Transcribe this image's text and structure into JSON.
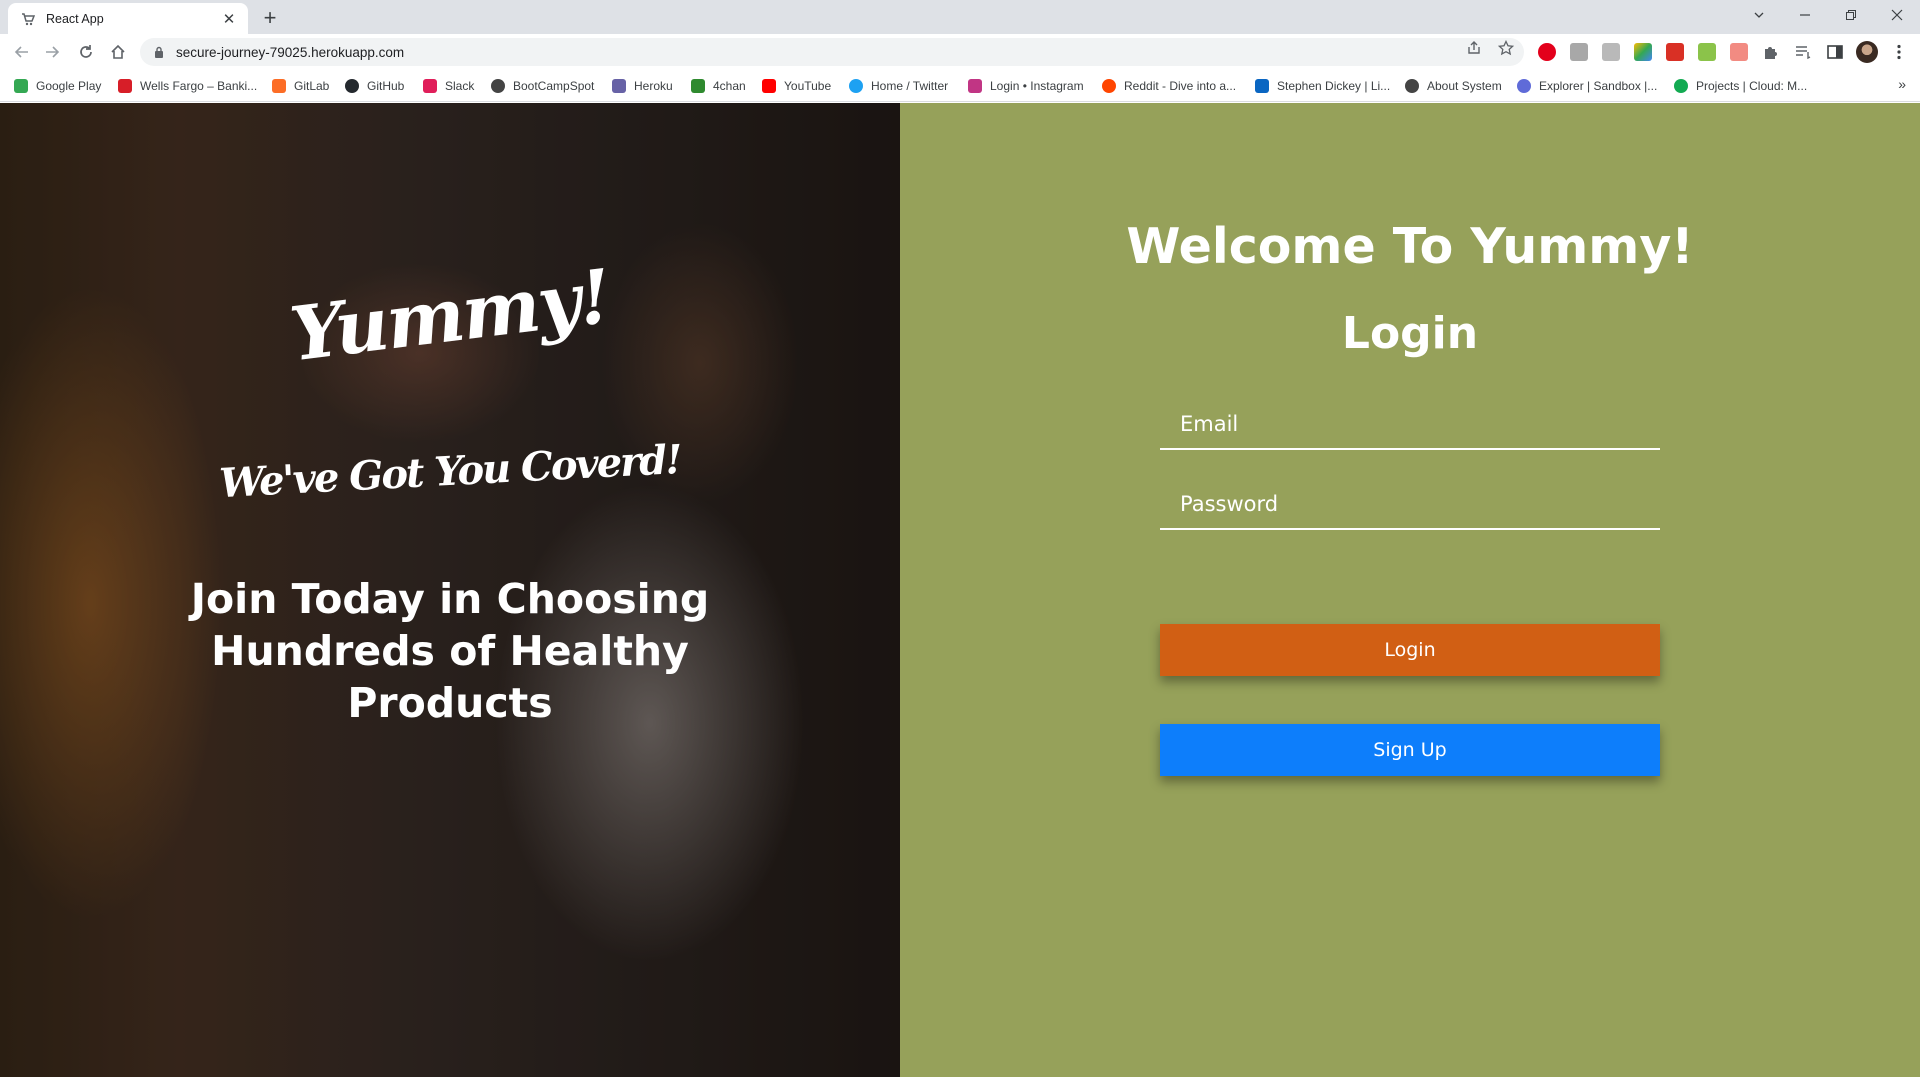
{
  "browser": {
    "tab_title": "React App",
    "tab_close_label": "✕",
    "new_tab_label": "+",
    "url": "secure-journey-79025.herokuapp.com",
    "bookmarks": [
      {
        "label": "Google Play",
        "color": "#34a853"
      },
      {
        "label": "Wells Fargo – Banki...",
        "color": "#d71e28"
      },
      {
        "label": "GitLab",
        "color": "#fc6d26"
      },
      {
        "label": "GitHub",
        "color": "#24292e"
      },
      {
        "label": "Slack",
        "color": "#e01e5a"
      },
      {
        "label": "BootCampSpot",
        "color": "#444444"
      },
      {
        "label": "Heroku",
        "color": "#6762a6"
      },
      {
        "label": "4chan",
        "color": "#2f8a2f"
      },
      {
        "label": "YouTube",
        "color": "#ff0000"
      },
      {
        "label": "Home / Twitter",
        "color": "#1da1f2"
      },
      {
        "label": "Login • Instagram",
        "color": "#c13584"
      },
      {
        "label": "Reddit - Dive into a...",
        "color": "#ff4500"
      },
      {
        "label": "Stephen Dickey | Li...",
        "color": "#0a66c2"
      },
      {
        "label": "About System",
        "color": "#444444"
      },
      {
        "label": "Explorer | Sandbox |...",
        "color": "#5f6bd8"
      },
      {
        "label": "Projects | Cloud: M...",
        "color": "#13aa52"
      }
    ],
    "bookmarks_more": "»"
  },
  "hero": {
    "title": "Yummy!",
    "tagline": "We've Got You Coverd!",
    "headline": "Join Today in Choosing Hundreds of Healthy Products"
  },
  "login": {
    "welcome": "Welcome To Yummy!",
    "heading": "Login",
    "email_placeholder": "Email",
    "password_placeholder": "Password",
    "login_button": "Login",
    "signup_button": "Sign Up"
  },
  "colors": {
    "panel_bg": "#96a15a",
    "login_button": "#d15f14",
    "signup_button": "#0d7efb"
  }
}
